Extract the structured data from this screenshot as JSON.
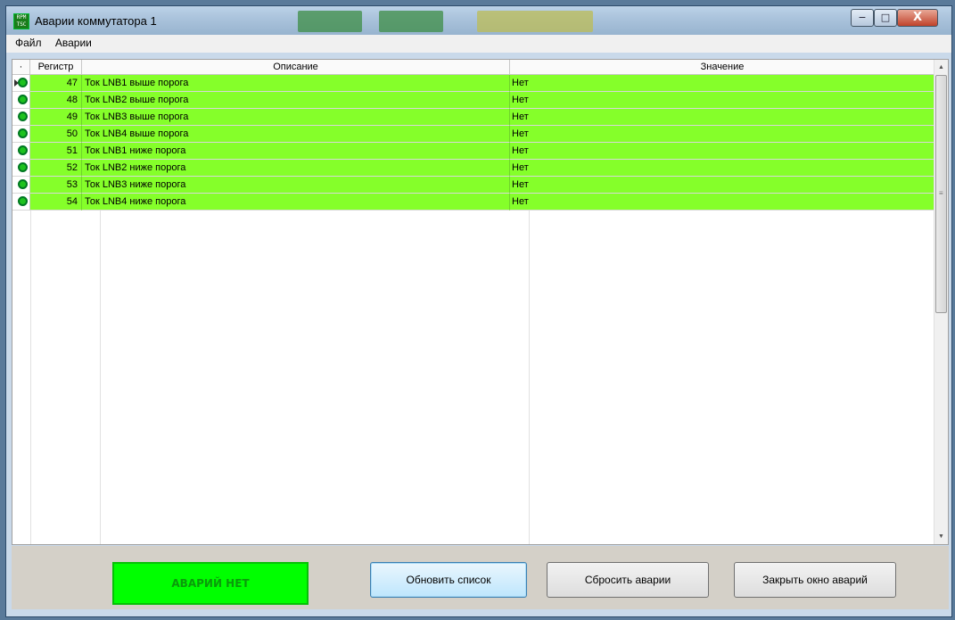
{
  "window": {
    "title": "Аварии коммутатора 1",
    "icon_text": "RPM TSC",
    "close_glyph": "X",
    "minimize_glyph": "−",
    "maximize_glyph": "□"
  },
  "menu": {
    "items": [
      "Файл",
      "Аварии"
    ]
  },
  "grid": {
    "columns": {
      "selector": "·",
      "register": "Регистр",
      "description": "Описание",
      "value": "Значение"
    },
    "rows": [
      {
        "register": "47",
        "description": "Ток LNB1 выше порога",
        "value": "Нет",
        "status_color": "#1ec21e",
        "selected": true
      },
      {
        "register": "48",
        "description": "Ток LNB2 выше порога",
        "value": "Нет",
        "status_color": "#1ec21e"
      },
      {
        "register": "49",
        "description": "Ток LNB3 выше порога",
        "value": "Нет",
        "status_color": "#1ec21e"
      },
      {
        "register": "50",
        "description": "Ток LNB4 выше порога",
        "value": "Нет",
        "status_color": "#1ec21e"
      },
      {
        "register": "51",
        "description": "Ток LNB1 ниже порога",
        "value": "Нет",
        "status_color": "#1ec21e"
      },
      {
        "register": "52",
        "description": "Ток LNB2 ниже порога",
        "value": "Нет",
        "status_color": "#1ec21e"
      },
      {
        "register": "53",
        "description": "Ток LNB3 ниже порога",
        "value": "Нет",
        "status_color": "#1ec21e"
      },
      {
        "register": "54",
        "description": "Ток LNB4 ниже порога",
        "value": "Нет",
        "status_color": "#1ec21e"
      }
    ],
    "row_color": "#85ff2a"
  },
  "status": {
    "text": "АВАРИЙ НЕТ",
    "color": "#00ff00"
  },
  "buttons": {
    "refresh": "Обновить список",
    "reset": "Сбросить аварии",
    "close": "Закрыть окно аварий"
  }
}
